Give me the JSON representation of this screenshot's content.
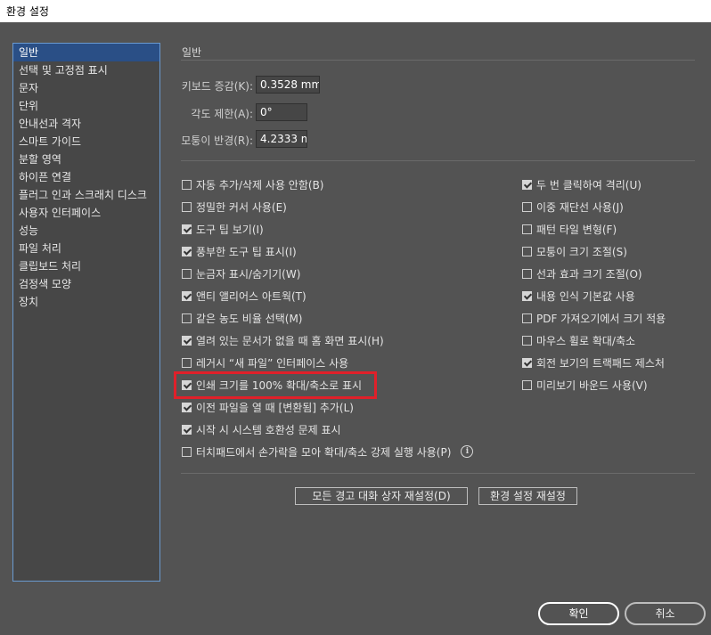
{
  "window": {
    "title": "환경 설정"
  },
  "sidebar": {
    "items": [
      {
        "label": "일반"
      },
      {
        "label": "선택 및 고정점 표시"
      },
      {
        "label": "문자"
      },
      {
        "label": "단위"
      },
      {
        "label": "안내선과 격자"
      },
      {
        "label": "스마트 가이드"
      },
      {
        "label": "분할 영역"
      },
      {
        "label": "하이픈 연결"
      },
      {
        "label": "플러그 인과 스크래치 디스크"
      },
      {
        "label": "사용자 인터페이스"
      },
      {
        "label": "성능"
      },
      {
        "label": "파일 처리"
      },
      {
        "label": "클립보드 처리"
      },
      {
        "label": "검정색 모양"
      },
      {
        "label": "장치"
      }
    ]
  },
  "general": {
    "section_title": "일반",
    "keyboard_increment": {
      "label": "키보드 증감(K):",
      "value": "0.3528 mm"
    },
    "constrain_angle": {
      "label": "각도 제한(A):",
      "value": "0°"
    },
    "corner_radius": {
      "label": "모퉁이 반경(R):",
      "value": "4.2333 m"
    },
    "left_options": [
      {
        "label": "자동 추가/삭제 사용 안함(B)",
        "checked": false
      },
      {
        "label": "정밀한 커서 사용(E)",
        "checked": false
      },
      {
        "label": "도구 팁 보기(I)",
        "checked": true
      },
      {
        "label": "풍부한 도구 팁 표시(I)",
        "checked": true
      },
      {
        "label": "눈금자 표시/숨기기(W)",
        "checked": false
      },
      {
        "label": "앤티 앨리어스 아트웍(T)",
        "checked": true
      },
      {
        "label": "같은 농도 비율 선택(M)",
        "checked": false
      },
      {
        "label": "열려 있는 문서가 없을 때 홈 화면 표시(H)",
        "checked": true
      },
      {
        "label": "레거시 “새 파일” 인터페이스 사용",
        "checked": false
      },
      {
        "label": "인쇄 크기를 100% 확대/축소로 표시",
        "checked": true
      },
      {
        "label": "이전 파일을 열 때 [변환됨] 추가(L)",
        "checked": true
      },
      {
        "label": "시작 시 시스템 호환성 문제 표시",
        "checked": true
      },
      {
        "label": "터치패드에서 손가락을 모아 확대/축소 강제 실행 사용(P)",
        "checked": false
      }
    ],
    "right_options": [
      {
        "label": "두 번 클릭하여 격리(U)",
        "checked": true
      },
      {
        "label": "이중 재단선 사용(J)",
        "checked": false
      },
      {
        "label": "패턴 타일 변형(F)",
        "checked": false
      },
      {
        "label": "모퉁이 크기 조절(S)",
        "checked": false
      },
      {
        "label": "선과 효과 크기 조절(O)",
        "checked": false
      },
      {
        "label": "내용 인식 기본값 사용",
        "checked": true
      },
      {
        "label": "PDF 가져오기에서 크기 적용",
        "checked": false
      },
      {
        "label": "마우스 휠로 확대/축소",
        "checked": false
      },
      {
        "label": "회전 보기의 트랙패드 제스처",
        "checked": true
      },
      {
        "label": "미리보기 바운드 사용(V)",
        "checked": false
      }
    ],
    "info_icon": "i",
    "reset_warnings_button": "모든 경고 대화 상자 재설정(D)",
    "reset_prefs_button": "환경 설정 재설정"
  },
  "footer": {
    "ok_label": "확인",
    "cancel_label": "취소"
  },
  "colors": {
    "highlight": "#e0202a",
    "sidebar_selected": "#2a4f86"
  }
}
